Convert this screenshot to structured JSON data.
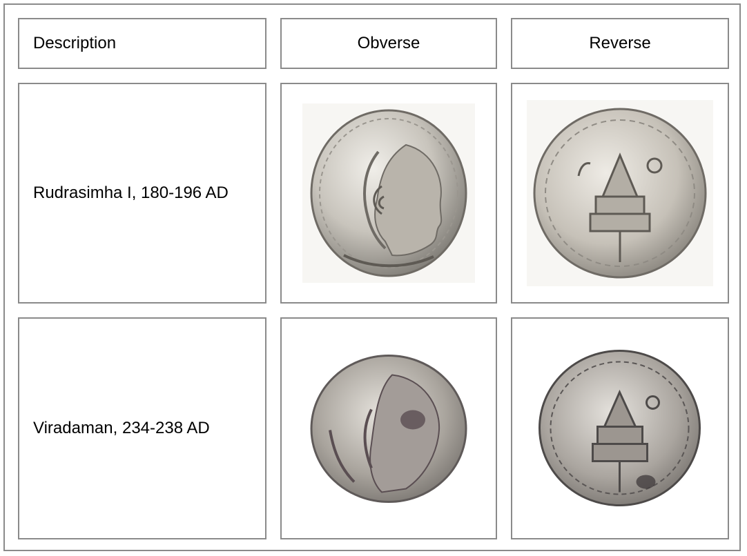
{
  "table": {
    "headers": {
      "description": "Description",
      "obverse": "Obverse",
      "reverse": "Reverse"
    },
    "rows": [
      {
        "description": "Rudrasimha I, 180-196 AD",
        "obverse_image": "silver-coin-obverse-portrait-icon",
        "reverse_image": "silver-coin-reverse-chaitya-icon"
      },
      {
        "description": "Viradaman, 234-238 AD",
        "obverse_image": "silver-coin-obverse-portrait-icon",
        "reverse_image": "silver-coin-reverse-chaitya-icon"
      }
    ]
  },
  "colors": {
    "border": "#8a8a8a",
    "coin_silver_light": "#d9d6d0",
    "coin_silver_dark": "#7d7a74",
    "coin_tarnish": "#5a4e52"
  }
}
